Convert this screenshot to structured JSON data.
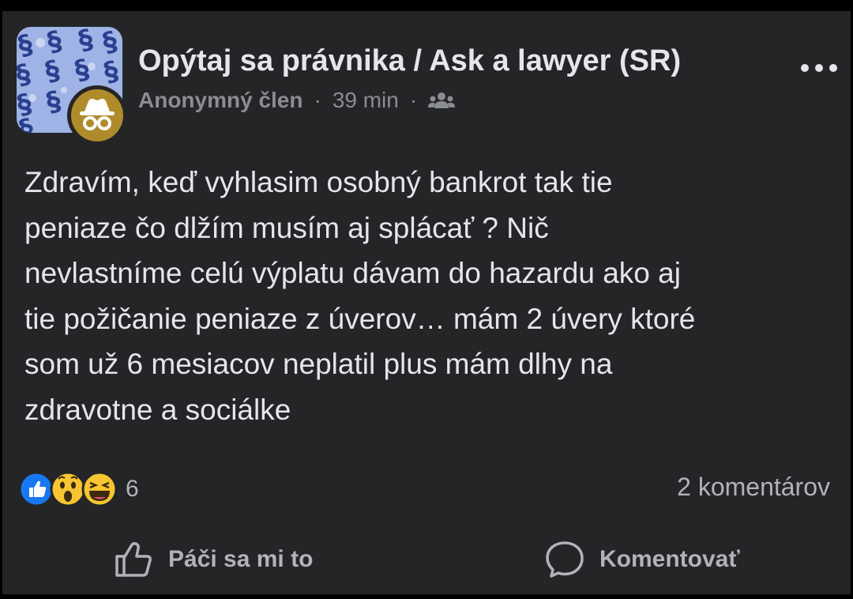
{
  "post": {
    "group_name": "Opýtaj sa právnika / Ask a lawyer (SR)",
    "author": "Anonymný člen",
    "separator": "·",
    "time": "39 min",
    "privacy_icon": "group-members-icon",
    "text": "Zdravím, keď vyhlasim osobný bankrot tak tie\npeniaze čo dlžím musím aj splácať ? Nič\nnevlastníme celú výplatu dávam do hazardu ako aj\ntie požičanie peniaze z úverov… mám 2 úvery ktoré\nsom už 6 mesiacov neplatil plus mám dlhy na\nzdravotne a sociálke",
    "reactions": [
      "like",
      "wow",
      "haha"
    ],
    "reaction_count": "6",
    "comment_count": "2 komentárov"
  },
  "actions": {
    "like_label": "Páči sa mi to",
    "comment_label": "Komentovať"
  },
  "colors": {
    "card_bg": "#242526",
    "text_primary": "#e4e6eb",
    "text_secondary": "#b0b3b8",
    "like_blue": "#1877f2",
    "reaction_yellow": "#f7c531",
    "anon_badge": "#b08b2c"
  }
}
